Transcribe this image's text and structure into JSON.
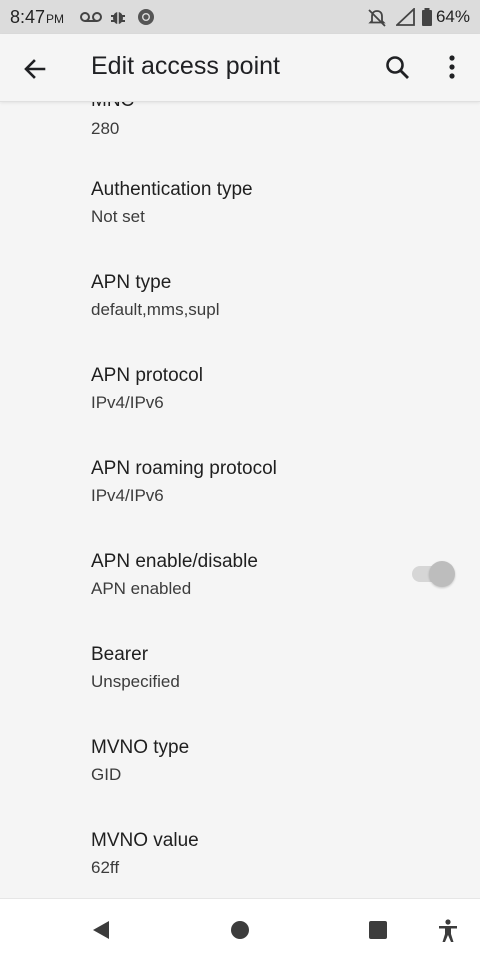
{
  "status_bar": {
    "time": "8:47",
    "ampm": "PM",
    "battery": "64%",
    "icons": [
      "voicemail-icon",
      "bug-icon",
      "chrome-icon",
      "do-not-disturb-off-icon",
      "signal-icon",
      "battery-icon"
    ]
  },
  "app_bar": {
    "title": "Edit access point",
    "icons": [
      "back-arrow-icon",
      "search-icon",
      "more-vert-icon"
    ]
  },
  "settings": {
    "partial_title": "MNC",
    "items": [
      {
        "title": "",
        "summary": "280"
      },
      {
        "title": "Authentication type",
        "summary": "Not set"
      },
      {
        "title": "APN type",
        "summary": "default,mms,supl"
      },
      {
        "title": "APN protocol",
        "summary": "IPv4/IPv6"
      },
      {
        "title": "APN roaming protocol",
        "summary": "IPv4/IPv6"
      },
      {
        "title": "APN enable/disable",
        "summary": "APN enabled",
        "toggle": true
      },
      {
        "title": "Bearer",
        "summary": "Unspecified"
      },
      {
        "title": "MVNO type",
        "summary": "GID"
      },
      {
        "title": "MVNO value",
        "summary": "62ff"
      }
    ]
  },
  "nav_bar": {
    "icons": [
      "back-triangle-icon",
      "home-circle-icon",
      "recents-square-icon",
      "accessibility-icon"
    ]
  },
  "colors": {
    "status_bar_bg": "#dcdcdc",
    "background": "#f5f5f5",
    "nav_bar_bg": "#ffffff"
  }
}
